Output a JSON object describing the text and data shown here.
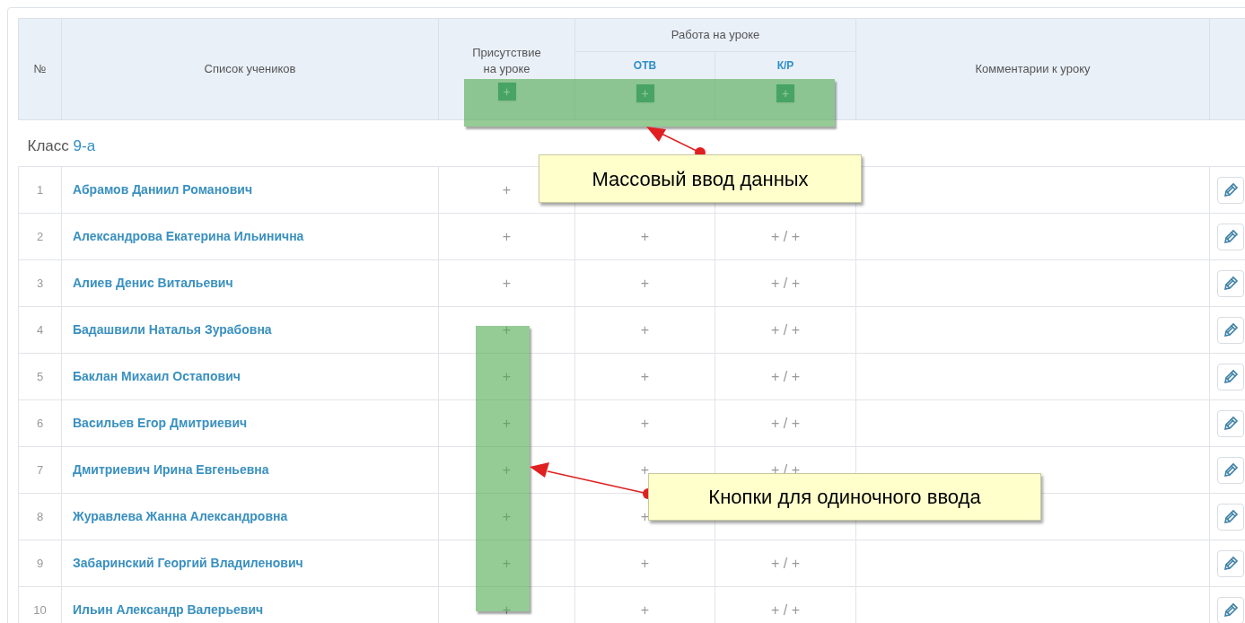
{
  "table": {
    "headers": {
      "number": "№",
      "students": "Список учеников",
      "attendance": "Присутствие\nна уроке",
      "work": "Работа на уроке",
      "answer": "ОТВ",
      "test": "К/Р",
      "comments": "Комментарии к уроку"
    },
    "mass_buttons": [
      "+",
      "+",
      "+"
    ],
    "group": {
      "prefix": "Класс",
      "name": "9-а"
    },
    "rows": [
      {
        "number": "1",
        "name": "Абрамов Даниил Романович",
        "attendance": "+"
      },
      {
        "number": "2",
        "name": "Александрова Екатерина Ильинична",
        "attendance": "+",
        "answer": "+",
        "test": "+ / +"
      },
      {
        "number": "3",
        "name": "Алиев Денис Витальевич",
        "attendance": "+",
        "answer": "+",
        "test": "+ / +"
      },
      {
        "number": "4",
        "name": "Бадашвили Наталья Зурабовна",
        "attendance": "+",
        "answer": "+",
        "test": "+ / +"
      },
      {
        "number": "5",
        "name": "Баклан Михаил Остапович",
        "attendance": "+",
        "answer": "+",
        "test": "+ / +"
      },
      {
        "number": "6",
        "name": "Васильев Егор Дмитриевич",
        "attendance": "+",
        "answer": "+",
        "test": "+ / +"
      },
      {
        "number": "7",
        "name": "Дмитриевич Ирина Евгеньевна",
        "attendance": "+",
        "answer": "+",
        "test": "+ / +"
      },
      {
        "number": "8",
        "name": "Журавлева Жанна Александровна",
        "attendance": "+",
        "answer": "+"
      },
      {
        "number": "9",
        "name": "Забаринский Георгий Владиленович",
        "attendance": "+",
        "answer": "+",
        "test": "+ / +"
      },
      {
        "number": "10",
        "name": "Ильин Александр Валерьевич",
        "attendance": "+",
        "answer": "+",
        "test": "+ / +"
      }
    ]
  },
  "callouts": [
    {
      "text": "Массовый ввод данных"
    },
    {
      "text": "Кнопки для одиночного ввода"
    }
  ]
}
